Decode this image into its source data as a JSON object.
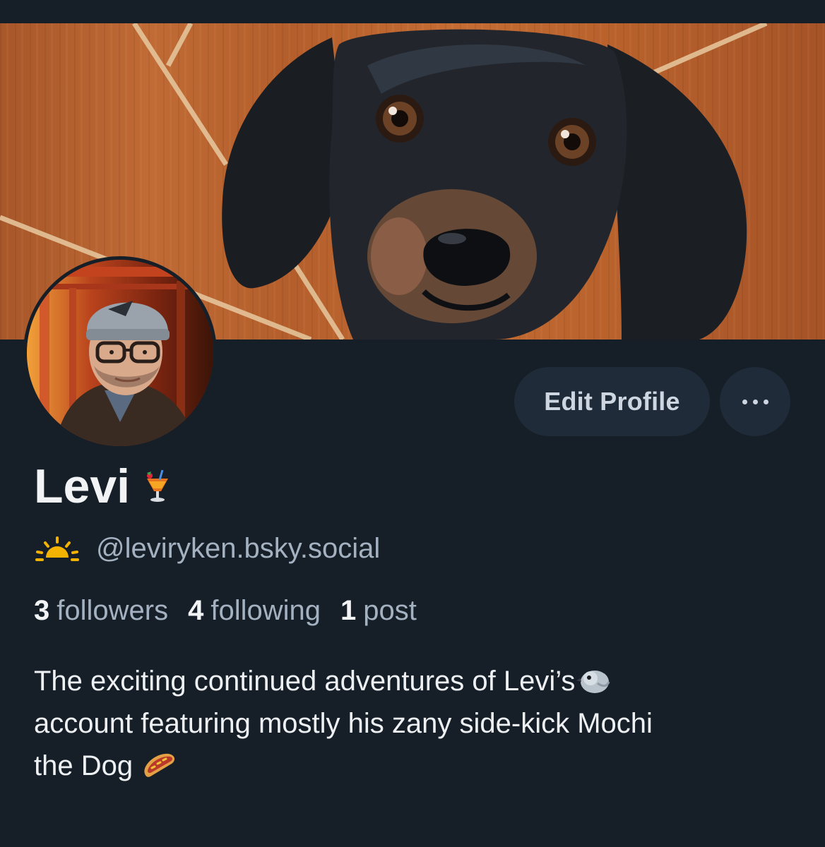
{
  "profile": {
    "display_name": "Levi",
    "display_name_emoji": "tropical-drink-emoji",
    "handle_icon": "sunrise-icon",
    "handle": "@leviryken.bsky.social",
    "stats": {
      "followers_count": "3",
      "followers_label": "followers",
      "following_count": "4",
      "following_label": "following",
      "posts_count": "1",
      "posts_label": "post"
    },
    "bio": {
      "line1": "The exciting continued adventures of Levi’s",
      "line1_emoji": "bird-emoji",
      "line2": "account featuring mostly his zany side-kick Mochi",
      "line3": "the Dog",
      "line3_emoji": "hot-dog-emoji"
    }
  },
  "actions": {
    "edit_label": "Edit Profile",
    "more_icon": "more-horizontal-icon"
  },
  "colors": {
    "background": "#161e27",
    "button_bg": "#1f2b38",
    "muted_text": "#a3b1c1",
    "accent_yellow": "#f5b301"
  }
}
